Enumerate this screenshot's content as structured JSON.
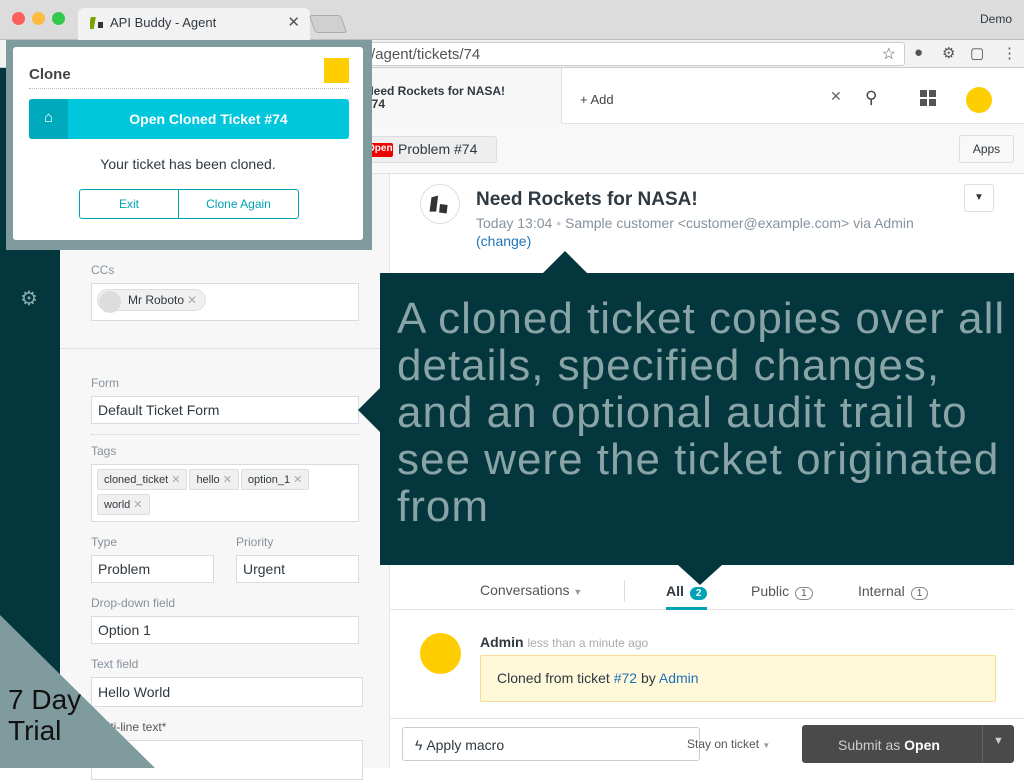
{
  "browser": {
    "tab_title": "API Buddy - Agent",
    "profile": "Demo",
    "url": "/agent/tickets/74"
  },
  "app": {
    "ticket_tab_title": "Need Rockets for NASA!",
    "ticket_tab_sub": "#74",
    "add_label": "Add",
    "status_badge": "Open",
    "ticket_chip": "Problem #74",
    "apps_label": "Apps"
  },
  "clone": {
    "title": "Clone",
    "open_button": "Open Cloned Ticket #74",
    "message": "Your ticket has been cloned.",
    "exit": "Exit",
    "clone_again": "Clone Again"
  },
  "left": {
    "ccs_label": "CCs",
    "cc": "Mr Roboto",
    "form_label": "Form",
    "form": "Default Ticket Form",
    "tags_label": "Tags",
    "tags": [
      "cloned_ticket",
      "hello",
      "option_1",
      "world"
    ],
    "type_label": "Type",
    "type": "Problem",
    "priority_label": "Priority",
    "priority": "Urgent",
    "dropdown_label": "Drop-down field",
    "dropdown": "Option 1",
    "text_label": "Text field",
    "text": "Hello World",
    "multiline_label": "Multi-line text*"
  },
  "ticket": {
    "title": "Need Rockets for NASA!",
    "time": "Today 13:04",
    "requester": "Sample customer <customer@example.com> via Admin",
    "change": "(change)"
  },
  "overlay": {
    "text": "A cloned ticket copies over all details, specified changes, and an optional audit trail to see were the ticket originated from"
  },
  "conversation": {
    "filter": "Conversations",
    "tabs": [
      {
        "label": "All",
        "count": "2"
      },
      {
        "label": "Public",
        "count": "1"
      },
      {
        "label": "Internal",
        "count": "1"
      }
    ],
    "author": "Admin",
    "when": "less than a minute ago",
    "msg_prefix": "Cloned from ticket",
    "msg_ticket": "#72",
    "msg_by": "by",
    "msg_author": "Admin"
  },
  "footer": {
    "macro": "Apply macro",
    "stay": "Stay on ticket",
    "submit_prefix": "Submit as",
    "submit_status": "Open"
  },
  "trial": {
    "line1": "7 Day",
    "line2": "Trial"
  },
  "colors": {
    "sidebar": "#03363d",
    "accent": "#00c7dc",
    "overlay_text": "#89a4a6",
    "trial": "#809b9d"
  }
}
